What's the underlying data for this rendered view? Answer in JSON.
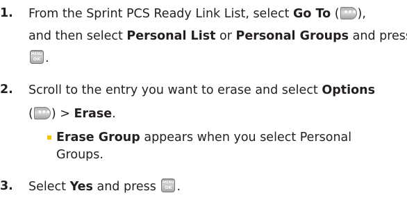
{
  "steps": [
    {
      "number": "1.",
      "line1": {
        "pre": "From the Sprint PCS Ready Link List, select ",
        "bold": "Go To",
        "post": " (",
        "close": "),"
      },
      "line2": {
        "pre": "and then select ",
        "bold1": "Personal List",
        "mid": " or ",
        "bold2": "Personal Groups",
        "post": " and press"
      },
      "line3": {
        "post": "."
      }
    },
    {
      "number": "2.",
      "line1": {
        "pre": "Scroll to the entry you want to erase and select ",
        "bold": "Options"
      },
      "line2": {
        "open": "(",
        "post": ") > ",
        "bold": "Erase",
        "end": "."
      },
      "bullet": {
        "bold": "Erase Group",
        "line1": " appears when you select Personal",
        "line2": "Groups."
      }
    },
    {
      "number": "3.",
      "line1": {
        "pre": "Select ",
        "bold": "Yes",
        "post": " and press ",
        "end": "."
      }
    }
  ],
  "keys": {
    "menu_ok": {
      "top_text": "MENU",
      "bottom_text": "OK",
      "icon": "menu-ok-key-icon"
    },
    "soft_key": {
      "glyph": "•••",
      "icon": "right-softkey-icon"
    }
  },
  "colors": {
    "text": "#231f20",
    "bullet": "#f5c400"
  }
}
